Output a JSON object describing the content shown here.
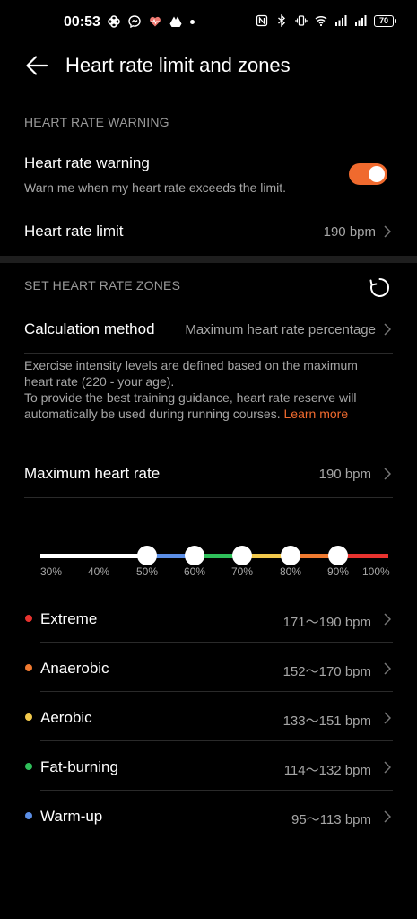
{
  "status_bar": {
    "time": "00:53",
    "battery": "70",
    "left_icons": [
      "pinwheel-icon",
      "messenger-icon",
      "health-icon",
      "drive-icon"
    ],
    "right_icons": [
      "nfc-icon",
      "bluetooth-icon",
      "vibrate-icon",
      "wifi-icon",
      "signal-icon",
      "signal-icon"
    ]
  },
  "header": {
    "title": "Heart rate limit and zones"
  },
  "warning_section": {
    "label": "HEART RATE WARNING",
    "warning_title": "Heart rate warning",
    "warning_sub": "Warn me when my heart rate exceeds the limit.",
    "warning_enabled": true,
    "limit_title": "Heart rate limit",
    "limit_value": "190 bpm"
  },
  "zones_section": {
    "label": "SET HEART RATE ZONES",
    "method_title": "Calculation method",
    "method_value": "Maximum heart rate percentage",
    "description_line1": "Exercise intensity levels are defined based on the maximum heart rate (220 - your age).",
    "description_line2": "To provide the best training guidance, heart rate reserve will automatically be used during running courses. ",
    "learn_more": "Learn more",
    "max_title": "Maximum heart rate",
    "max_value": "190 bpm"
  },
  "slider": {
    "ticks": [
      "30%",
      "40%",
      "50%",
      "60%",
      "70%",
      "80%",
      "90%",
      "100%"
    ],
    "knob_values_percent": [
      50,
      60,
      70,
      80,
      90
    ]
  },
  "zones": [
    {
      "name": "Extreme",
      "range": "171～190 bpm",
      "color": "#e8332f"
    },
    {
      "name": "Anaerobic",
      "range": "152～170 bpm",
      "color": "#f07a30"
    },
    {
      "name": "Aerobic",
      "range": "133～151 bpm",
      "color": "#f2c94c"
    },
    {
      "name": "Fat-burning",
      "range": "114～132 bpm",
      "color": "#2fbf5a"
    },
    {
      "name": "Warm-up",
      "range": "95～113 bpm",
      "color": "#5b8ee6"
    }
  ],
  "colors": {
    "accent": "#f06a2e",
    "track_white": "#ffffff",
    "track_blue": "#5b8ee6",
    "track_green": "#2fbf5a",
    "track_yellow": "#f2c94c",
    "track_orange": "#f07a30",
    "track_red": "#e8332f"
  }
}
